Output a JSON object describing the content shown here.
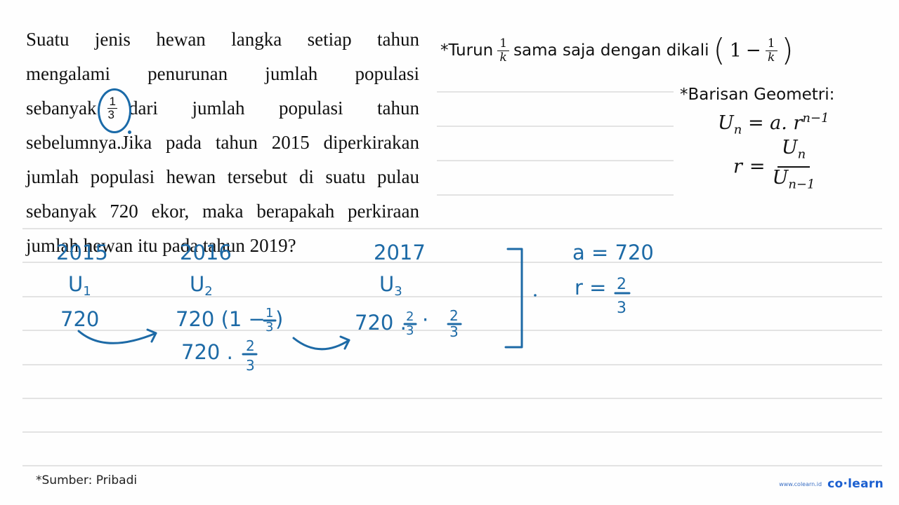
{
  "question": {
    "lines": [
      "Suatu jenis hewan langka setiap tahun",
      "mengalami penurunan jumlah populasi",
      "sebanyak",
      "dari jumlah populasi tahun",
      "sebelumnya.Jika pada tahun 2015 diperkirakan",
      "jumlah populasi hewan tersebut di suatu pulau",
      "sebanyak 720 ekor, maka berapakah perkiraan",
      "jumlah hewan itu pada tahun 2019?"
    ],
    "fraction": {
      "numerator": "1",
      "denominator": "3"
    }
  },
  "hint_turun": {
    "prefix": "*Turun",
    "frac_num": "1",
    "frac_den": "k",
    "middle": "sama saja dengan dikali",
    "paren_open": "(",
    "one": "1",
    "minus": "−",
    "paren_close": ")"
  },
  "geometric": {
    "title": "*Barisan Geometri:",
    "un": "U",
    "un_sub": "n",
    "eq": "=",
    "a_dot_r": "a. r",
    "exp": "n−1",
    "r": "r",
    "denom_sub": "n−1"
  },
  "handwriting": {
    "years": [
      "2015",
      "2016",
      "2017"
    ],
    "terms": [
      {
        "U": "U",
        "sub": "1"
      },
      {
        "U": "U",
        "sub": "2"
      },
      {
        "U": "U",
        "sub": "3"
      }
    ],
    "u1_value": "720",
    "u2_value": "720 (1 − ",
    "u2_frac": {
      "n": "1",
      "d": "3"
    },
    "u2_close": ")",
    "u2_simplified": "720 . ",
    "u2_simplified_frac": {
      "n": "2",
      "d": "3"
    },
    "u3_value": "720 . ",
    "u3_frac1": {
      "n": "2",
      "d": "3"
    },
    "u3_dot": "·",
    "u3_frac2": {
      "n": "2",
      "d": "3"
    },
    "a_label": "a = 720",
    "r_label": "r = ",
    "r_frac": {
      "n": "2",
      "d": "3"
    },
    "ink_color": "#1d6aa6"
  },
  "footer": {
    "source": "*Sumber: Pribadi",
    "url": "www.colearn.id",
    "brand": "co·learn"
  }
}
